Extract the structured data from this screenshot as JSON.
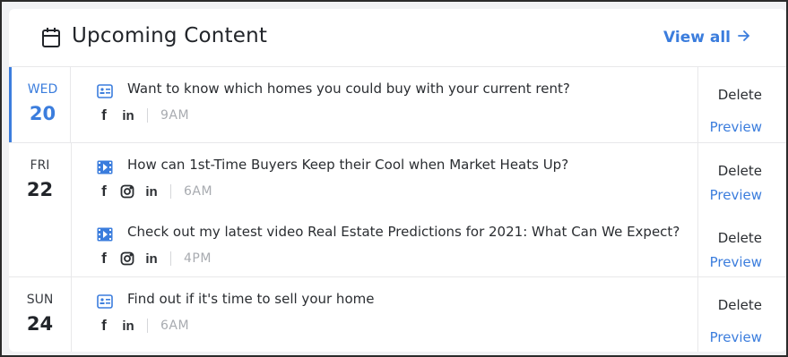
{
  "header": {
    "title": "Upcoming Content",
    "view_all": "View all"
  },
  "colors": {
    "accent": "#3b7ddd",
    "text": "#22252a",
    "muted": "#a8abb0"
  },
  "days": [
    {
      "dow": "WED",
      "day": "20",
      "active": true,
      "posts": [
        {
          "type": "post-card-icon",
          "title": "Want to know which homes you could buy with your current rent?",
          "networks": [
            "facebook-icon",
            "linkedin-icon"
          ],
          "time": "9AM",
          "delete": "Delete",
          "preview": "Preview"
        }
      ]
    },
    {
      "dow": "FRI",
      "day": "22",
      "active": false,
      "posts": [
        {
          "type": "video-icon",
          "title": "How can 1st-Time Buyers Keep their Cool when Market Heats Up?",
          "networks": [
            "facebook-icon",
            "instagram-icon",
            "linkedin-icon"
          ],
          "time": "6AM",
          "delete": "Delete",
          "preview": "Preview"
        },
        {
          "type": "video-icon",
          "title": "Check out my latest video Real Estate Predictions for 2021: What Can We Expect?",
          "networks": [
            "facebook-icon",
            "instagram-icon",
            "linkedin-icon"
          ],
          "time": "4PM",
          "delete": "Delete",
          "preview": "Preview"
        }
      ]
    },
    {
      "dow": "SUN",
      "day": "24",
      "active": false,
      "posts": [
        {
          "type": "post-card-icon",
          "title": "Find out if it's time to sell your home",
          "networks": [
            "facebook-icon",
            "linkedin-icon"
          ],
          "time": "6AM",
          "delete": "Delete",
          "preview": "Preview"
        }
      ]
    }
  ]
}
